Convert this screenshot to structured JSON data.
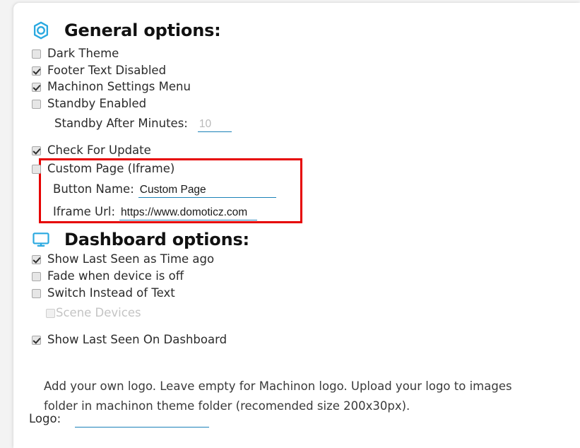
{
  "card": {
    "accent_color": "#1b82b8",
    "annotation_color": "#e60000"
  },
  "general_section": {
    "icon": "gear-icon",
    "title": "General options:",
    "checkboxes": [
      {
        "label": "Dark Theme",
        "checked": false
      },
      {
        "label": "Footer Text Disabled",
        "checked": true
      },
      {
        "label": "Machinon Settings Menu",
        "checked": true
      },
      {
        "label": "Standby Enabled",
        "checked": false
      }
    ],
    "standby_minutes": {
      "label": "Standby After Minutes:",
      "value": "10",
      "placeholder": "10"
    },
    "check_for_update": {
      "label": "Check For Update",
      "checked": true
    },
    "custom_page": {
      "label": "Custom Page (Iframe)",
      "checked": false
    },
    "button_name": {
      "label": "Button Name:",
      "value": "Custom Page",
      "placeholder": "Custom Page"
    },
    "iframe_url": {
      "label": "Iframe Url:",
      "value": "https://www.domoticz.com",
      "placeholder": "https://www.domoticz.com"
    }
  },
  "dashboard_section": {
    "icon": "monitor-icon",
    "title": "Dashboard options:",
    "checkboxes": [
      {
        "label": "Show Last Seen as Time ago",
        "checked": true
      },
      {
        "label": "Fade when device is off",
        "checked": false
      },
      {
        "label": "Switch Instead of Text",
        "checked": false
      },
      {
        "label": "Scene Devices",
        "checked": false,
        "disabled": true
      },
      {
        "label": "Show Last Seen On Dashboard",
        "checked": true
      }
    ]
  },
  "logo_section": {
    "help_text": "Add your own logo. Leave empty for Machinon logo. Upload your logo to images folder in machinon theme folder (recomended size 200x30px).",
    "logo_field": {
      "label": "Logo:",
      "value": "",
      "placeholder": ""
    }
  }
}
